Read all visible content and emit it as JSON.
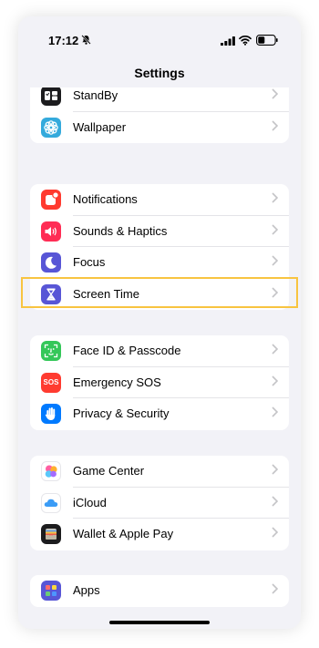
{
  "status_bar": {
    "time": "17:12",
    "icons": [
      "bell-off-icon",
      "signal-icon",
      "wifi-icon",
      "battery-icon"
    ]
  },
  "nav": {
    "title": "Settings"
  },
  "groups": [
    {
      "items": [
        {
          "label": "StandBy",
          "icon": "standby-icon",
          "color": "#1c1c1e"
        },
        {
          "label": "Wallpaper",
          "icon": "wallpaper-icon",
          "color": "#34aadc"
        }
      ]
    },
    {
      "items": [
        {
          "label": "Notifications",
          "icon": "notifications-icon",
          "color": "#ff3b30"
        },
        {
          "label": "Sounds & Haptics",
          "icon": "speaker-icon",
          "color": "#ff2d55"
        },
        {
          "label": "Focus",
          "icon": "moon-icon",
          "color": "#5856d6"
        },
        {
          "label": "Screen Time",
          "icon": "hourglass-icon",
          "color": "#5856d6"
        }
      ]
    },
    {
      "items": [
        {
          "label": "Face ID & Passcode",
          "icon": "face-id-icon",
          "color": "#34c759"
        },
        {
          "label": "Emergency SOS",
          "icon": "sos-icon",
          "color": "#ff3b30",
          "icon_text": "SOS",
          "highlighted": true
        },
        {
          "label": "Privacy & Security",
          "icon": "hand-icon",
          "color": "#007aff"
        }
      ]
    },
    {
      "items": [
        {
          "label": "Game Center",
          "icon": "game-center-icon",
          "color": "#ffffff"
        },
        {
          "label": "iCloud",
          "icon": "icloud-icon",
          "color": "#ffffff"
        },
        {
          "label": "Wallet & Apple Pay",
          "icon": "wallet-icon",
          "color": "#1c1c1e"
        }
      ]
    },
    {
      "items": [
        {
          "label": "Apps",
          "icon": "apps-icon",
          "color": "#5856d6"
        }
      ]
    }
  ],
  "highlight_color": "#f8c440"
}
